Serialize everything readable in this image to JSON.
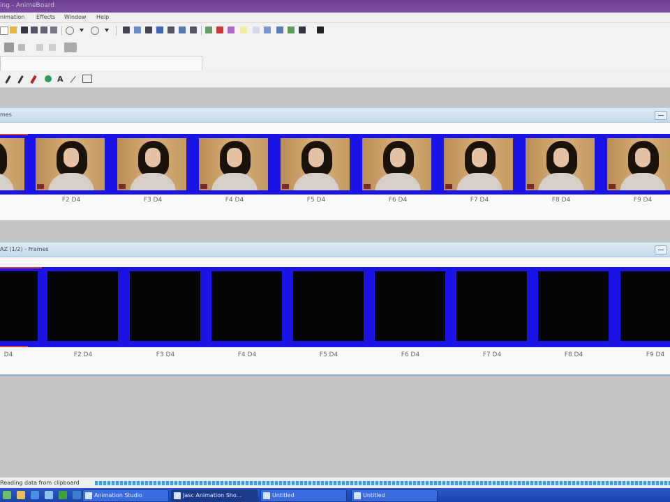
{
  "window": {
    "title": "ing - AnimeBoard"
  },
  "menu": [
    "nimation",
    "Effects",
    "Window",
    "Help"
  ],
  "panels": {
    "top": {
      "title": "mes",
      "labels": [
        "F2 D4",
        "F3 D4",
        "F4 D4",
        "F5 D4",
        "F6 D4",
        "F7 D4",
        "F8 D4",
        "F9 D4"
      ]
    },
    "bottom": {
      "title": "AZ (1/2) - Frames",
      "labels": [
        "D4",
        "F2 D4",
        "F3 D4",
        "F4 D4",
        "F5 D4",
        "F6 D4",
        "F7 D4",
        "F8 D4",
        "F9 D4"
      ]
    }
  },
  "status": {
    "text": "Reading data from clipboard"
  },
  "taskbar": {
    "items": [
      "Animation Studio",
      "Jasc Animation Sho...",
      "Untitled",
      "Untitled"
    ]
  },
  "colors": {
    "strip": "#1a14e6",
    "titlebar": "#7f4fa3",
    "taskbar": "#1d44a8"
  }
}
